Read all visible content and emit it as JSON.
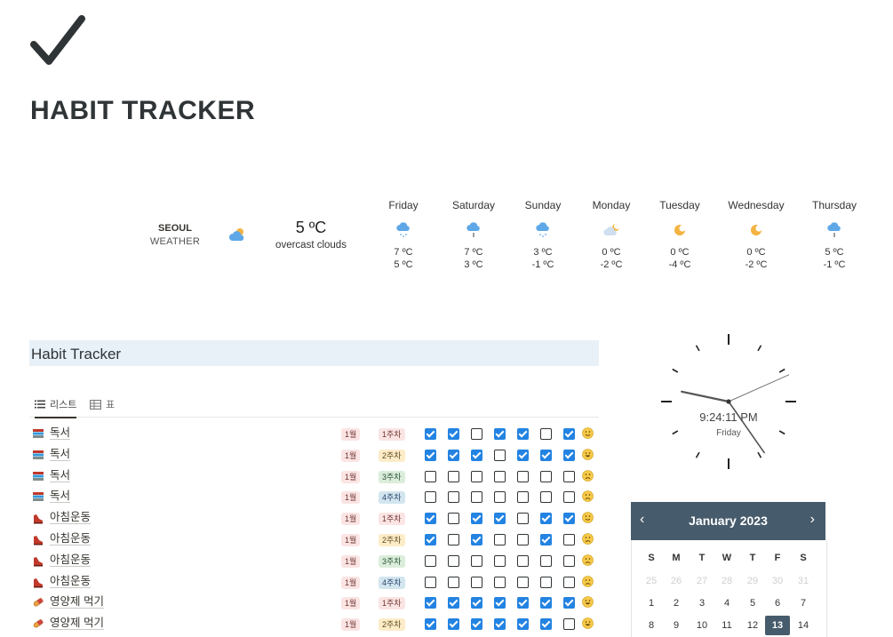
{
  "page": {
    "title": "HABIT TRACKER",
    "icon": "check-icon"
  },
  "weather": {
    "city": "SEOUL",
    "label": "WEATHER",
    "current": {
      "temp": "5 ºC",
      "desc": "overcast clouds",
      "icon": "cloud-sun-icon"
    },
    "forecast": [
      {
        "day": "Friday",
        "icon": "snow-cloud-icon",
        "hi": "7 ºC",
        "lo": "5 ºC"
      },
      {
        "day": "Saturday",
        "icon": "rain-cloud-icon",
        "hi": "7 ºC",
        "lo": "3 ºC"
      },
      {
        "day": "Sunday",
        "icon": "snow-cloud-icon",
        "hi": "3 ºC",
        "lo": "-1 ºC"
      },
      {
        "day": "Monday",
        "icon": "cloud-moon-icon",
        "hi": "0 ºC",
        "lo": "-2 ºC"
      },
      {
        "day": "Tuesday",
        "icon": "moon-icon",
        "hi": "0 ºC",
        "lo": "-4 ºC"
      },
      {
        "day": "Wednesday",
        "icon": "moon-icon",
        "hi": "0 ºC",
        "lo": "-2 ºC"
      },
      {
        "day": "Thursday",
        "icon": "rain-cloud-icon",
        "hi": "5 ºC",
        "lo": "-1 ºC"
      }
    ]
  },
  "habit": {
    "title": "Habit Tracker",
    "tabs": [
      {
        "label": "리스트",
        "icon": "list-icon"
      },
      {
        "label": "표",
        "icon": "table-icon"
      }
    ],
    "rows": [
      {
        "icon": "books-icon",
        "name": "독서",
        "month": "1월",
        "week": "1주차",
        "checks": [
          true,
          true,
          false,
          true,
          true,
          false,
          true
        ],
        "mood": "neutral"
      },
      {
        "icon": "books-icon",
        "name": "독서",
        "month": "1월",
        "week": "2주차",
        "checks": [
          true,
          true,
          true,
          false,
          true,
          true,
          true
        ],
        "mood": "happy"
      },
      {
        "icon": "books-icon",
        "name": "독서",
        "month": "1월",
        "week": "3주차",
        "checks": [
          false,
          false,
          false,
          false,
          false,
          false,
          false
        ],
        "mood": "sad"
      },
      {
        "icon": "books-icon",
        "name": "독서",
        "month": "1월",
        "week": "4주차",
        "checks": [
          false,
          false,
          false,
          false,
          false,
          false,
          false
        ],
        "mood": "sad"
      },
      {
        "icon": "running-shoe-icon",
        "name": "아침운동",
        "month": "1월",
        "week": "1주차",
        "checks": [
          true,
          false,
          true,
          true,
          false,
          true,
          true
        ],
        "mood": "neutral"
      },
      {
        "icon": "running-shoe-icon",
        "name": "아침운동",
        "month": "1월",
        "week": "2주차",
        "checks": [
          true,
          false,
          true,
          false,
          false,
          true,
          false
        ],
        "mood": "sad"
      },
      {
        "icon": "running-shoe-icon",
        "name": "아침운동",
        "month": "1월",
        "week": "3주차",
        "checks": [
          false,
          false,
          false,
          false,
          false,
          false,
          false
        ],
        "mood": "sad"
      },
      {
        "icon": "running-shoe-icon",
        "name": "아침운동",
        "month": "1월",
        "week": "4주차",
        "checks": [
          false,
          false,
          false,
          false,
          false,
          false,
          false
        ],
        "mood": "sad"
      },
      {
        "icon": "pill-icon",
        "name": "영양제 먹기",
        "month": "1월",
        "week": "1주차",
        "checks": [
          true,
          true,
          true,
          true,
          true,
          true,
          true
        ],
        "mood": "happy"
      },
      {
        "icon": "pill-icon",
        "name": "영양제 먹기",
        "month": "1월",
        "week": "2주차",
        "checks": [
          true,
          true,
          true,
          true,
          true,
          true,
          false
        ],
        "mood": "happy"
      }
    ]
  },
  "clock": {
    "time": "9:24:11 PM",
    "day": "Friday"
  },
  "calendar": {
    "title": "January 2023",
    "prev": "‹",
    "next": "›",
    "weekdays": [
      "S",
      "M",
      "T",
      "W",
      "T",
      "F",
      "S"
    ],
    "prev_month_days": [
      "25",
      "26",
      "27",
      "28",
      "29",
      "30",
      "31"
    ],
    "days": [
      "1",
      "2",
      "3",
      "4",
      "5",
      "6",
      "7",
      "8",
      "9",
      "10",
      "11",
      "12",
      "13",
      "14"
    ],
    "today": "13"
  },
  "colors": {
    "accent": "#2383e2",
    "calendar_header": "#465b6b",
    "section_bg": "#e8f1f7"
  }
}
